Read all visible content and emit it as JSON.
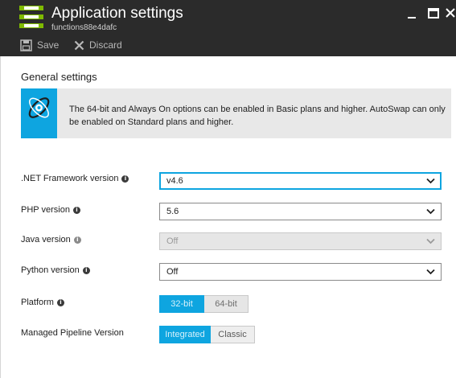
{
  "window": {
    "title": "Application settings",
    "subtitle": "functions88e4dafc"
  },
  "toolbar": {
    "save_label": "Save",
    "discard_label": "Discard"
  },
  "general": {
    "section_title": "General settings",
    "info_message": "The 64-bit and Always On options can be enabled in Basic plans and higher. AutoSwap can only be enabled on Standard plans and higher."
  },
  "settings": {
    "net_framework": {
      "label": ".NET Framework version",
      "value": "v4.6"
    },
    "php": {
      "label": "PHP version",
      "value": "5.6"
    },
    "java": {
      "label": "Java version",
      "value": "Off"
    },
    "python": {
      "label": "Python version",
      "value": "Off"
    },
    "platform": {
      "label": "Platform",
      "options": [
        "32-bit",
        "64-bit"
      ],
      "selected": "32-bit"
    },
    "pipeline": {
      "label": "Managed Pipeline Version",
      "options": [
        "Integrated",
        "Classic"
      ],
      "selected": "Integrated"
    }
  },
  "colors": {
    "accent": "#0ea5e0",
    "header_bg": "#2b2b2b",
    "info_bg": "#e8e8e8"
  },
  "icons": {
    "app": "app-settings-icon",
    "save": "save-icon",
    "discard": "close-icon",
    "info": "info-icon"
  }
}
